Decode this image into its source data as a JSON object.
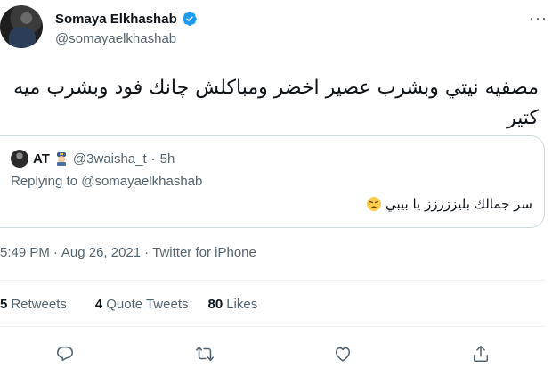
{
  "author": {
    "name": "Somaya Elkhashab",
    "handle": "@somayaelkhashab",
    "more_icon": "more-horizontal-icon"
  },
  "tweet": {
    "text": "مصفيه نيتي وبشرب عصير اخضر ومباكلش چانك فود وبشرب ميه كتير"
  },
  "quoted": {
    "name": "AT",
    "handle": "@3waisha_t",
    "time": "5h",
    "replying_to": "Replying to @somayaelkhashab",
    "text": "سر جمالك بليززززز يا بيبي"
  },
  "meta": {
    "time": "5:49 PM",
    "date": "Aug 26, 2021",
    "source": "Twitter for iPhone"
  },
  "stats": {
    "retweets_count": "5",
    "retweets_label": "Retweets",
    "quotes_count": "4",
    "quotes_label": "Quote Tweets",
    "likes_count": "80",
    "likes_label": "Likes"
  },
  "actions": [
    "reply-icon",
    "retweet-icon",
    "like-icon",
    "share-icon"
  ],
  "colors": {
    "accent": "#1d9bf0",
    "muted": "#536471",
    "text": "#0f1419",
    "border": "#cfd9de"
  }
}
